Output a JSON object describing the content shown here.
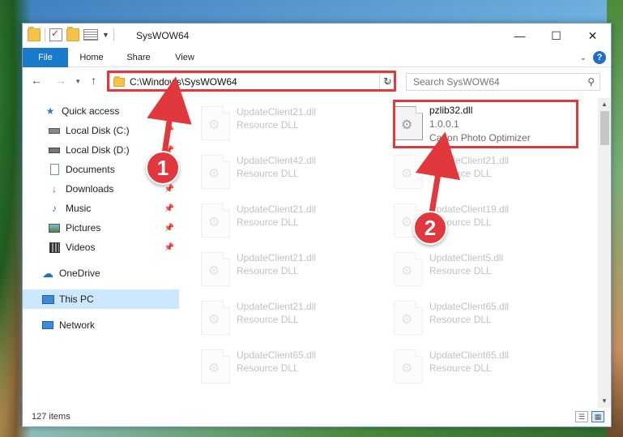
{
  "window": {
    "title": "SysWOW64",
    "controls": {
      "minimize": "—",
      "maximize": "☐",
      "close": "✕"
    }
  },
  "ribbon": {
    "tabs": [
      "File",
      "Home",
      "Share",
      "View"
    ],
    "help": "?"
  },
  "address": {
    "path": "C:\\Windows\\SysWOW64",
    "search_placeholder": "Search SysWOW64"
  },
  "sidebar": {
    "items": [
      {
        "label": "Quick access",
        "icon": "star-icon",
        "pinned": false
      },
      {
        "label": "Local Disk (C:)",
        "icon": "drive-icon",
        "pinned": true
      },
      {
        "label": "Local Disk (D:)",
        "icon": "drive-icon",
        "pinned": true
      },
      {
        "label": "Documents",
        "icon": "documents-icon",
        "pinned": true
      },
      {
        "label": "Downloads",
        "icon": "downloads-icon",
        "pinned": true
      },
      {
        "label": "Music",
        "icon": "music-icon",
        "pinned": true
      },
      {
        "label": "Pictures",
        "icon": "pictures-icon",
        "pinned": true
      },
      {
        "label": "Videos",
        "icon": "videos-icon",
        "pinned": true
      },
      {
        "label": "OneDrive",
        "icon": "onedrive-icon",
        "pinned": false
      },
      {
        "label": "This PC",
        "icon": "this-pc-icon",
        "pinned": false,
        "selected": true
      },
      {
        "label": "Network",
        "icon": "network-icon",
        "pinned": false
      }
    ]
  },
  "files": {
    "highlighted": {
      "name": "pzlib32.dll",
      "version": "1.0.0.1",
      "description": "Canon Photo Optimizer"
    },
    "left_column": [
      {
        "name": "UpdateClient21.dll",
        "type": "Resource DLL"
      },
      {
        "name": "UpdateClient42.dll",
        "type": "Resource DLL"
      },
      {
        "name": "UpdateClient21.dll",
        "type": "Resource DLL"
      },
      {
        "name": "UpdateClient21.dll",
        "type": "Resource DLL"
      },
      {
        "name": "UpdateClient21.dll",
        "type": "Resource DLL"
      },
      {
        "name": "UpdateClient65.dll",
        "type": "Resource DLL"
      }
    ],
    "right_column": [
      {
        "name": "UpdateClient21.dll",
        "type": "Resource DLL"
      },
      {
        "name": "UpdateClient19.dll",
        "type": "Resource DLL"
      },
      {
        "name": "UpdateClient5.dll",
        "type": "Resource DLL"
      },
      {
        "name": "UpdateClient65.dll",
        "type": "Resource DLL"
      },
      {
        "name": "UpdateClient65.dll",
        "type": "Resource DLL"
      }
    ]
  },
  "status": {
    "item_count": "127 items"
  },
  "annotations": {
    "step1": "1",
    "step2": "2",
    "color": "#e0383c"
  }
}
